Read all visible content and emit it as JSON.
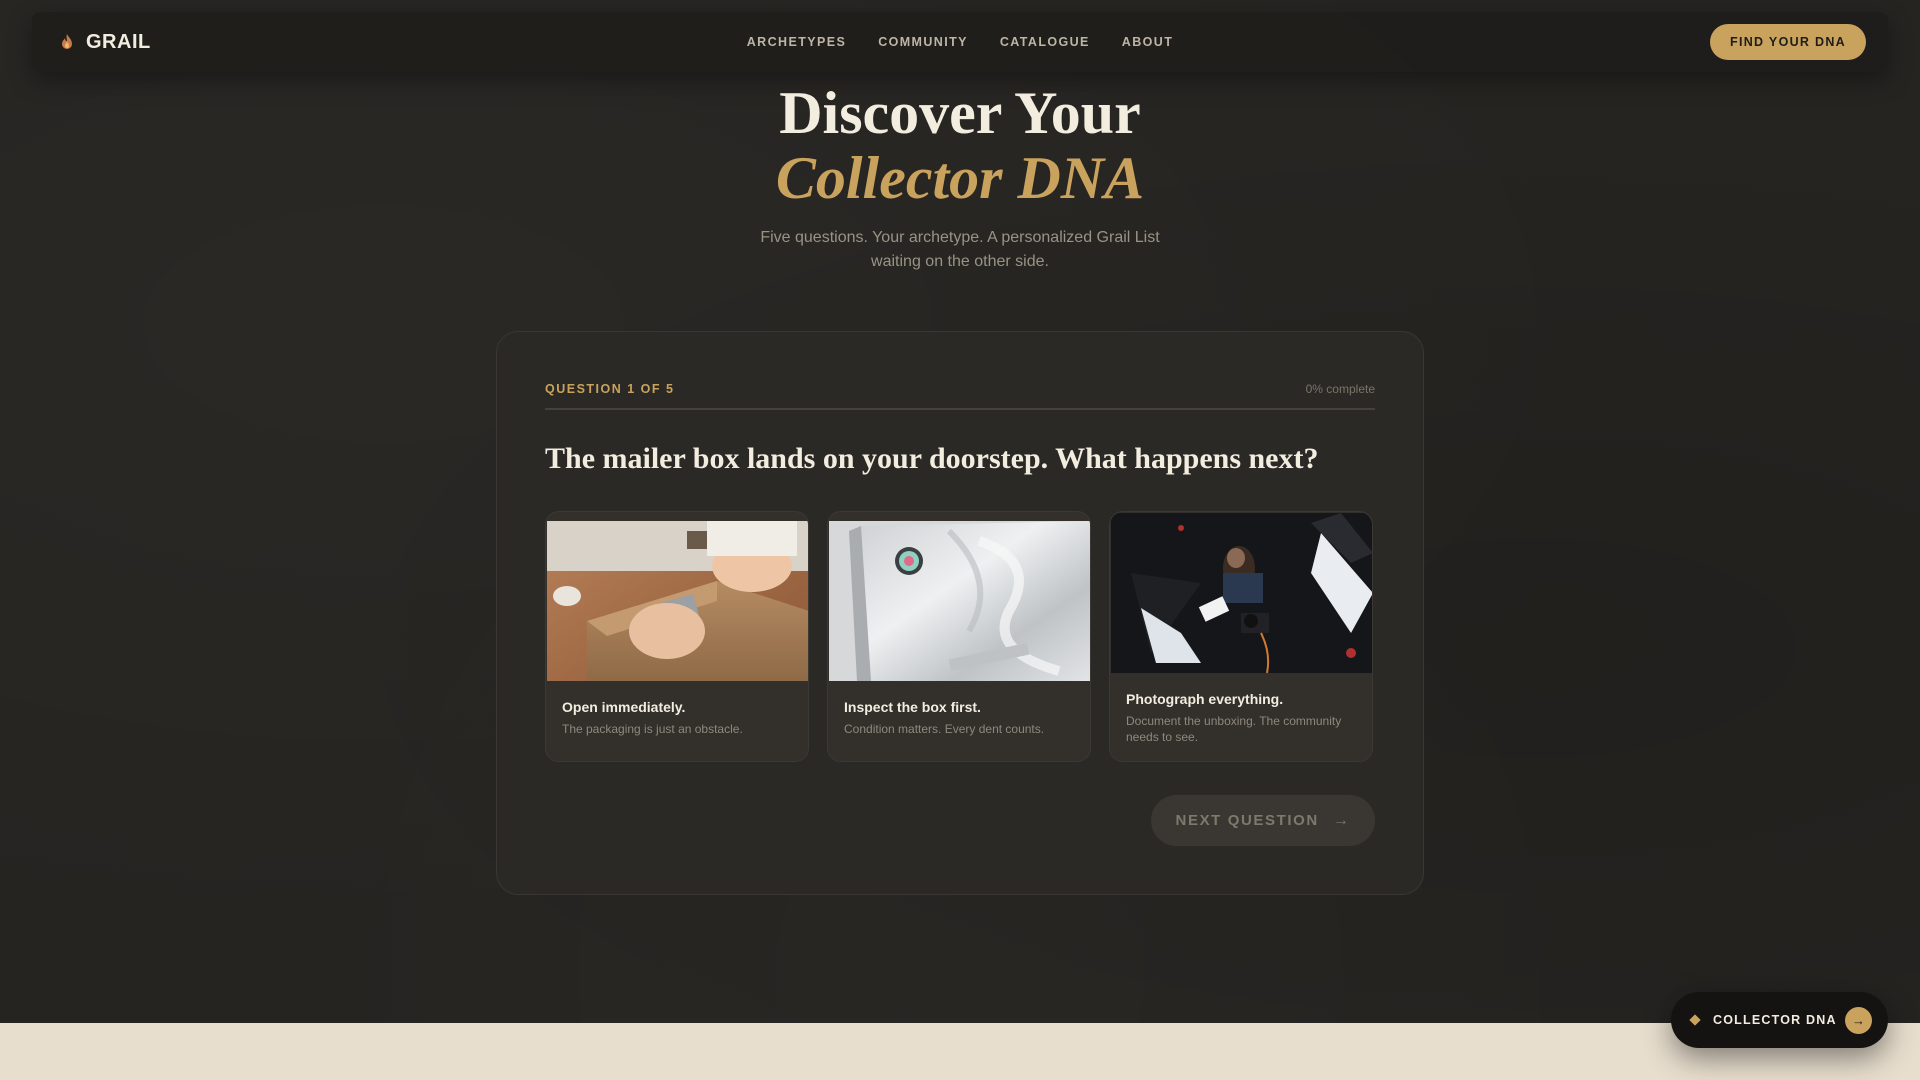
{
  "brand": {
    "name": "GRAIL",
    "icon": "flame-icon"
  },
  "nav": {
    "links": [
      "ARCHETYPES",
      "COMMUNITY",
      "CATALOGUE",
      "ABOUT"
    ],
    "cta": "FIND YOUR DNA"
  },
  "hero": {
    "title_line1": "Discover Your",
    "title_line2": "Collector DNA",
    "subtitle": "Five questions. Your archetype. A personalized Grail List waiting on the other side."
  },
  "quiz": {
    "question_label": "QUESTION 1 OF 5",
    "progress_text": "0% complete",
    "progress": 0,
    "question": "The mailer box lands on your doorstep. What happens next?",
    "options": [
      {
        "title": "Open immediately.",
        "description": "The packaging is just an obstacle.",
        "image": "hands-opening-cardboard-box-photo"
      },
      {
        "title": "Inspect the box first.",
        "description": "Condition matters. Every dent counts.",
        "image": "sealed-holographic-box-photo"
      },
      {
        "title": "Photograph everything.",
        "description": "Document the unboxing. The community needs to see.",
        "image": "photo-studio-setup-photo"
      }
    ],
    "next_label": "NEXT QUESTION",
    "next_icon": "arrow-right-icon"
  },
  "floating": {
    "label": "COLLECTOR DNA",
    "icon": "diamond-icon",
    "action_icon": "arrow-right-icon"
  },
  "colors": {
    "accent": "#c9a35d",
    "background": "#262421",
    "card": "#2b2926",
    "band": "#e8dece"
  }
}
